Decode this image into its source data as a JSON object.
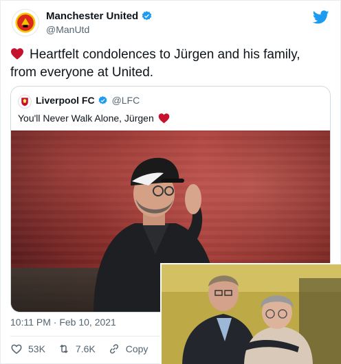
{
  "header": {
    "name": "Manchester United",
    "handle": "@ManUtd"
  },
  "tweet": {
    "text_line1": "Heartfelt condolences to Jürgen and his family,",
    "text_line2": "from everyone at United."
  },
  "quote": {
    "name": "Liverpool FC",
    "handle": "@LFC",
    "text": "You'll Never Walk Alone, Jürgen"
  },
  "meta": {
    "timestamp": "10:11 PM · Feb 10, 2021"
  },
  "actions": {
    "likes": "53K",
    "retweets": "7.6K",
    "copy_label": "Copy"
  },
  "colors": {
    "heart": "#c4122f",
    "verified": "#1d9bf0",
    "twitter": "#1d9bf0",
    "muted": "#536471"
  },
  "icons": [
    "manutd-crest-icon",
    "verified-badge-icon",
    "twitter-bird-icon",
    "heart-icon",
    "lfc-crest-icon",
    "like-icon",
    "retweet-icon",
    "link-icon"
  ]
}
